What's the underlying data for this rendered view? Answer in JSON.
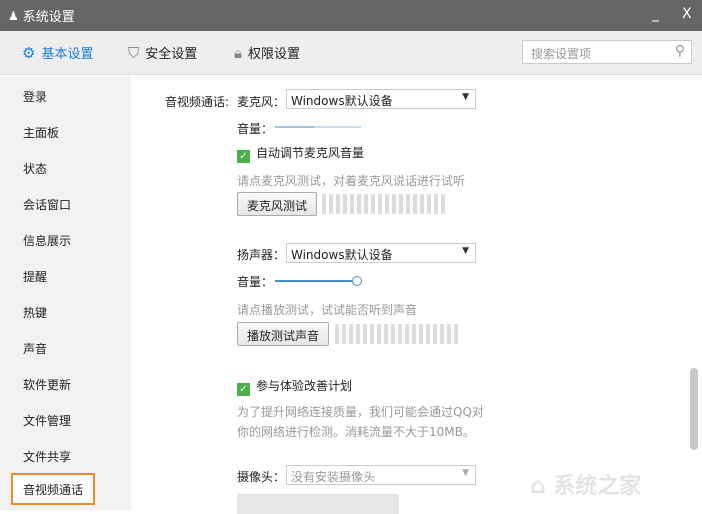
{
  "window": {
    "title": "系统设置",
    "minimize": "_",
    "close": "X"
  },
  "tabs": [
    {
      "label": "基本设置",
      "active": true
    },
    {
      "label": "安全设置"
    },
    {
      "label": "权限设置"
    }
  ],
  "search": {
    "placeholder": "搜索设置项"
  },
  "sidebar": {
    "items": [
      "登录",
      "主面板",
      "状态",
      "会话窗口",
      "信息展示",
      "提醒",
      "热键",
      "声音",
      "软件更新",
      "文件管理",
      "文件共享"
    ],
    "selected": "音视频通话"
  },
  "av": {
    "section_label": "音视频通话:",
    "mic_label": "麦克风：",
    "mic_value": "Windows默认设备",
    "volume_label": "音量：",
    "mic_volume": 0.45,
    "auto_adjust": "自动调节麦克风音量",
    "mic_hint": "请点麦克风测试，对着麦克风说话进行试听",
    "mic_test": "麦克风测试",
    "speaker_label": "扬声器：",
    "speaker_value": "Windows默认设备",
    "speaker_volume_label": "音量：",
    "speaker_volume": 1.0,
    "speaker_hint": "请点播放测试，试试能否听到声音",
    "speaker_test": "播放测试声音",
    "improve": "参与体验改善计划",
    "improve_desc1": "为了提升网络连接质量，我们可能会通过QQ对",
    "improve_desc2": "你的网络进行检测。消耗流量不大于10MB。",
    "camera_label": "摄像头：",
    "camera_value": "没有安装摄像头"
  },
  "watermark": "系统之家",
  "colors": {
    "accent": "#1e7fd8",
    "selected_border": "#f08a2c",
    "check": "#4caf50"
  }
}
